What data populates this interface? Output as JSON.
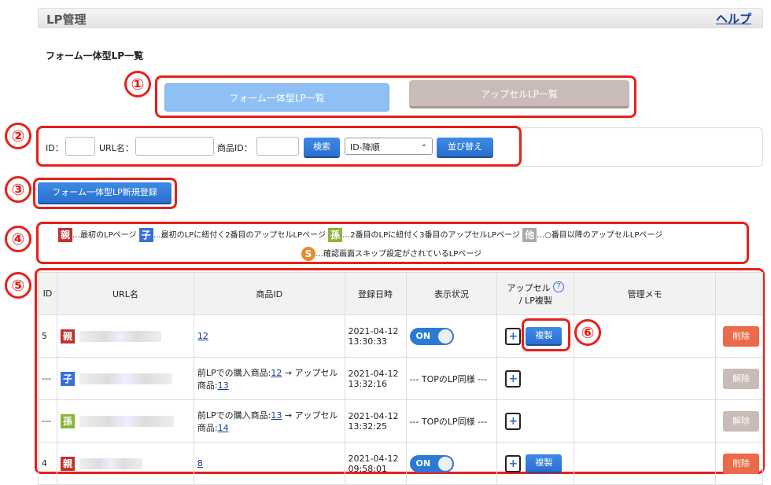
{
  "header": {
    "title": "LP管理",
    "help": "ヘルプ"
  },
  "page_title": "フォーム一体型LP一覧",
  "annotations": [
    "①",
    "②",
    "③",
    "④",
    "⑤",
    "⑥"
  ],
  "tabs": {
    "active": "フォーム一体型LP一覧",
    "inactive": "アップセルLP一覧"
  },
  "search": {
    "id_label": "ID：",
    "url_label": "URL名：",
    "product_label": "商品ID：",
    "search_button": "検索",
    "sort_selected": "ID-降順",
    "sort_button": "並び替え"
  },
  "new_button": "フォーム一体型LP新規登録",
  "legend": {
    "oya_tag": "親",
    "oya_text": "…最初のLPページ",
    "ko_tag": "子",
    "ko_text": "…最初のLPに紐付く2番目のアップセルLPページ",
    "mago_tag": "孫",
    "mago_text": "…2番目のLPに紐付く3番目のアップセルLPページ",
    "ta_tag": "他",
    "ta_text": "…○番目以降のアップセルLPページ",
    "s_tag": "S",
    "s_text": "…確認画面スキップ設定がされているLPページ"
  },
  "table": {
    "headers": {
      "id": "ID",
      "url": "URL名",
      "product": "商品ID",
      "date": "登録日時",
      "status": "表示状況",
      "upsell": "アップセル",
      "upsell2": "/ LP複製",
      "memo": "管理メモ"
    },
    "help_icon": "?",
    "rows": [
      {
        "id": "5",
        "tag": "親",
        "product": "12",
        "date1": "2021-04-12",
        "date2": "13:30:33",
        "status": "ON",
        "copy": "複製",
        "action": "削除"
      },
      {
        "id": "---",
        "tag": "子",
        "prod_prefix": "前LPでの購入商品:",
        "prod_a": "12",
        "prod_mid": " → アップセル",
        "prod_line2": "商品:",
        "prod_b": "13",
        "date1": "2021-04-12",
        "date2": "13:32:16",
        "status": "--- TOPのLP同様 ---",
        "action": "解除"
      },
      {
        "id": "---",
        "tag": "孫",
        "prod_prefix": "前LPでの購入商品:",
        "prod_a": "13",
        "prod_mid": " → アップセル",
        "prod_line2": "商品:",
        "prod_b": "14",
        "date1": "2021-04-12",
        "date2": "13:32:25",
        "status": "--- TOPのLP同様 ---",
        "action": "解除"
      },
      {
        "id": "4",
        "tag": "親",
        "product": "8",
        "date1": "2021-04-12",
        "date2": "09:58:01",
        "status": "ON",
        "copy": "複製",
        "action": "削除"
      }
    ],
    "plus": "+"
  }
}
